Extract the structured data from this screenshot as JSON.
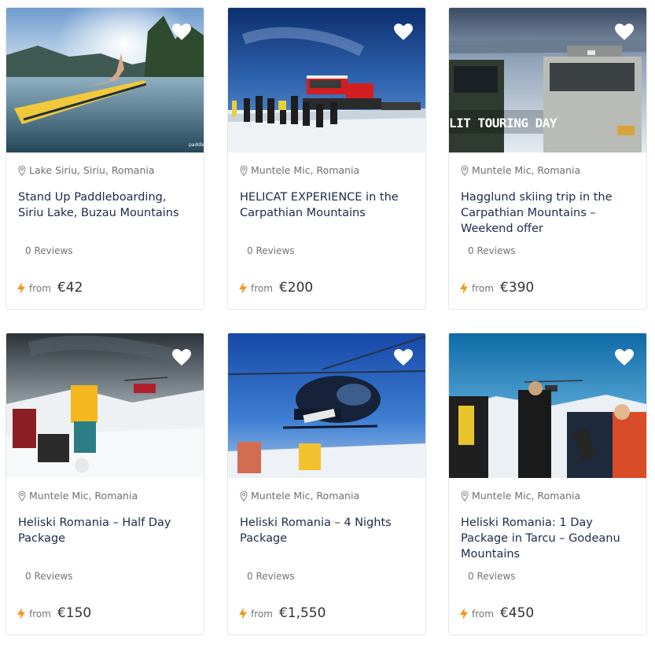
{
  "cards": [
    {
      "location": "Lake Siriu, Siriu, Romania",
      "title": "Stand Up Paddleboarding, Siriu Lake, Buzau Mountains",
      "reviews": "0 Reviews",
      "from_label": "from",
      "price": "€42",
      "image": "paddleboard-lake",
      "image_caption": "paddle"
    },
    {
      "location": "Muntele Mic, Romania",
      "title": "HELICAT EXPERIENCE in the Carpathian Mountains",
      "reviews": "0 Reviews",
      "from_label": "from",
      "price": "€200",
      "image": "snowcat-group"
    },
    {
      "location": "Muntele Mic, Romania",
      "title": "Hagglund skiing trip in the Carpathian Mountains – Weekend offer",
      "reviews": "0 Reviews",
      "from_label": "from",
      "price": "€390",
      "image": "hagglund-vehicles",
      "image_caption": "LIT TOURING DAY"
    },
    {
      "location": "Muntele Mic, Romania",
      "title": "Heliski Romania – Half Day Package",
      "reviews": "0 Reviews",
      "from_label": "from",
      "price": "€150",
      "image": "heliski-snow-crouch"
    },
    {
      "location": "Muntele Mic, Romania",
      "title": "Heliski Romania – 4 Nights Package",
      "reviews": "0 Reviews",
      "from_label": "from",
      "price": "€1,550",
      "image": "helicopter-landing"
    },
    {
      "location": "Muntele Mic, Romania",
      "title": "Heliski Romania: 1 Day Package in Tarcu – Godeanu Mountains",
      "reviews": "0 Reviews",
      "from_label": "from",
      "price": "€450",
      "image": "skier-group-helicopter"
    }
  ],
  "colors": {
    "title": "#1a2b49",
    "muted": "#737373",
    "bolt": "#f7941d",
    "border": "#e6e6e6"
  },
  "icons": {
    "wishlist": "heart-icon",
    "location": "map-pin-icon",
    "price": "lightning-bolt-icon"
  }
}
